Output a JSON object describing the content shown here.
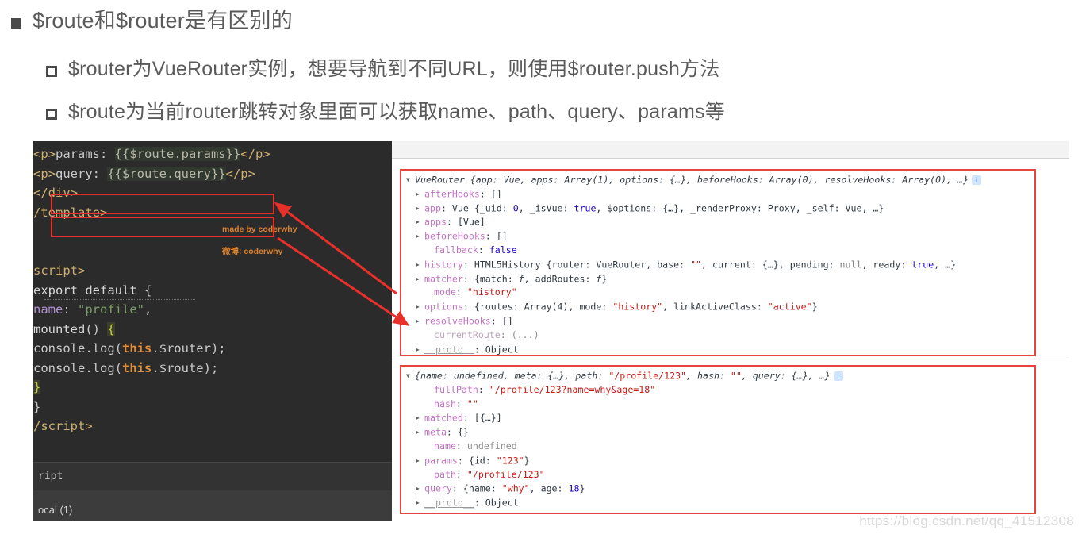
{
  "slide": {
    "bullets": [
      {
        "level": 1,
        "marker": "filled-square",
        "text": "$route和$router是有区别的"
      },
      {
        "level": 2,
        "marker": "hollow-square",
        "text": "$router为VueRouter实例，想要导航到不同URL，则使用$router.push方法"
      },
      {
        "level": 2,
        "marker": "hollow-square",
        "text": "$route为当前router跳转对象里面可以获取name、path、query、params等"
      }
    ]
  },
  "editor": {
    "watermark_line1": "made by coderwhy",
    "watermark_line2": "微博: coderwhy",
    "status_bar": "ript",
    "bottom_bar": "ocal (1)",
    "lines": [
      {
        "indent": 3,
        "parts": [
          {
            "t": "<p>",
            "c": "c-tag"
          },
          {
            "t": "params: ",
            "c": "c-plain"
          },
          {
            "t": "{{$route.params}}",
            "c": "c-mustache"
          },
          {
            "t": "</p>",
            "c": "c-tag"
          }
        ]
      },
      {
        "indent": 3,
        "parts": [
          {
            "t": "<p>",
            "c": "c-tag"
          },
          {
            "t": "query: ",
            "c": "c-plain"
          },
          {
            "t": "{{$route.query}}",
            "c": "c-mustache"
          },
          {
            "t": "</p>",
            "c": "c-tag"
          }
        ]
      },
      {
        "indent": 1,
        "parts": [
          {
            "t": "</div>",
            "c": "c-tag"
          }
        ]
      },
      {
        "indent": 0,
        "parts": [
          {
            "t": "/template>",
            "c": "c-tag"
          }
        ]
      },
      {
        "indent": 0,
        "parts": [
          {
            "t": "",
            "c": "c-plain"
          }
        ]
      },
      {
        "indent": 0,
        "parts": [
          {
            "t": "",
            "c": "c-plain"
          }
        ]
      },
      {
        "indent": 0,
        "parts": [
          {
            "t": "script>",
            "c": "c-tag"
          }
        ]
      },
      {
        "indent": 1,
        "parts": [
          {
            "t": "export default",
            "c": "c-kw"
          },
          {
            "t": " {",
            "c": "c-plain"
          }
        ]
      },
      {
        "indent": 2,
        "parts": [
          {
            "t": "name",
            "c": "c-key"
          },
          {
            "t": ": ",
            "c": "c-plain"
          },
          {
            "t": "\"profile\"",
            "c": "c-str"
          },
          {
            "t": ",",
            "c": "c-plain"
          }
        ]
      },
      {
        "indent": 2,
        "parts": [
          {
            "t": "mounted",
            "c": "c-fn"
          },
          {
            "t": "() ",
            "c": "c-plain"
          },
          {
            "t": "{",
            "c": "c-brace"
          }
        ]
      },
      {
        "indent": 3,
        "parts": [
          {
            "t": "console.log(",
            "c": "c-plain"
          },
          {
            "t": "this",
            "c": "c-this"
          },
          {
            "t": ".$router);",
            "c": "c-plain"
          }
        ]
      },
      {
        "indent": 3,
        "parts": [
          {
            "t": "console.log(",
            "c": "c-plain"
          },
          {
            "t": "this",
            "c": "c-this"
          },
          {
            "t": ".$route);",
            "c": "c-plain"
          }
        ]
      },
      {
        "indent": 2,
        "parts": [
          {
            "t": "}",
            "c": "c-brace"
          }
        ]
      },
      {
        "indent": 1,
        "parts": [
          {
            "t": "}",
            "c": "c-plain"
          }
        ]
      },
      {
        "indent": 0,
        "parts": [
          {
            "t": "/script>",
            "c": "c-tag"
          }
        ]
      }
    ],
    "highlight_boxes": [
      {
        "name": "console-log-router",
        "code": "console.log(this.$router);"
      },
      {
        "name": "console-log-route",
        "code": "console.log(this.$route);"
      }
    ]
  },
  "devtools": {
    "entries": [
      {
        "name": "vuerouter-object",
        "rows": [
          {
            "lvl": 0,
            "tri": "▼",
            "parts": [
              {
                "t": "VueRouter {app: Vue, apps: Array(1), options: {…}, beforeHooks: Array(0), resolveHooks: Array(0), …}",
                "c": "v-obj"
              }
            ],
            "badge": "i"
          },
          {
            "lvl": 1,
            "tri": "▶",
            "parts": [
              {
                "t": "afterHooks",
                "c": "k-prop"
              },
              {
                "t": ": []",
                "c": "v-plain"
              }
            ]
          },
          {
            "lvl": 1,
            "tri": "▶",
            "parts": [
              {
                "t": "app",
                "c": "k-prop"
              },
              {
                "t": ": Vue {_uid: ",
                "c": "v-plain"
              },
              {
                "t": "0",
                "c": "v-num"
              },
              {
                "t": ", _isVue: ",
                "c": "v-plain"
              },
              {
                "t": "true",
                "c": "v-bool"
              },
              {
                "t": ", $options: {…}, _renderProxy: Proxy, _self: Vue, …}",
                "c": "v-plain"
              }
            ]
          },
          {
            "lvl": 1,
            "tri": "▶",
            "parts": [
              {
                "t": "apps",
                "c": "k-prop"
              },
              {
                "t": ": [Vue]",
                "c": "v-plain"
              }
            ]
          },
          {
            "lvl": 1,
            "tri": "▶",
            "parts": [
              {
                "t": "beforeHooks",
                "c": "k-prop"
              },
              {
                "t": ": []",
                "c": "v-plain"
              }
            ]
          },
          {
            "lvl": 2,
            "tri": "",
            "parts": [
              {
                "t": "fallback",
                "c": "k-prop"
              },
              {
                "t": ": ",
                "c": "v-plain"
              },
              {
                "t": "false",
                "c": "v-bool"
              }
            ]
          },
          {
            "lvl": 1,
            "tri": "▶",
            "parts": [
              {
                "t": "history",
                "c": "k-prop"
              },
              {
                "t": ": HTML5History {router: VueRouter, base: ",
                "c": "v-plain"
              },
              {
                "t": "\"\"",
                "c": "v-str"
              },
              {
                "t": ", current: {…}, pending: ",
                "c": "v-plain"
              },
              {
                "t": "null",
                "c": "v-null"
              },
              {
                "t": ", ready: ",
                "c": "v-plain"
              },
              {
                "t": "true",
                "c": "v-bool"
              },
              {
                "t": ", …}",
                "c": "v-plain"
              }
            ]
          },
          {
            "lvl": 1,
            "tri": "▶",
            "parts": [
              {
                "t": "matcher",
                "c": "k-prop"
              },
              {
                "t": ": {match: ",
                "c": "v-plain"
              },
              {
                "t": "f",
                "c": "v-fn"
              },
              {
                "t": ", addRoutes: ",
                "c": "v-plain"
              },
              {
                "t": "f",
                "c": "v-fn"
              },
              {
                "t": "}",
                "c": "v-plain"
              }
            ]
          },
          {
            "lvl": 2,
            "tri": "",
            "parts": [
              {
                "t": "mode",
                "c": "k-prop"
              },
              {
                "t": ": ",
                "c": "v-plain"
              },
              {
                "t": "\"history\"",
                "c": "v-str"
              }
            ]
          },
          {
            "lvl": 1,
            "tri": "▶",
            "parts": [
              {
                "t": "options",
                "c": "k-prop"
              },
              {
                "t": ": {routes: Array(4), mode: ",
                "c": "v-plain"
              },
              {
                "t": "\"history\"",
                "c": "v-str"
              },
              {
                "t": ", linkActiveClass: ",
                "c": "v-plain"
              },
              {
                "t": "\"active\"",
                "c": "v-str"
              },
              {
                "t": "}",
                "c": "v-plain"
              }
            ]
          },
          {
            "lvl": 1,
            "tri": "▶",
            "parts": [
              {
                "t": "resolveHooks",
                "c": "k-prop"
              },
              {
                "t": ": []",
                "c": "v-plain"
              }
            ]
          },
          {
            "lvl": 2,
            "tri": "",
            "parts": [
              {
                "t": "currentRoute",
                "c": "k-propd"
              },
              {
                "t": ": (...)",
                "c": "v-undef"
              }
            ]
          },
          {
            "lvl": 1,
            "tri": "▶",
            "parts": [
              {
                "t": "__proto__",
                "c": "proto"
              },
              {
                "t": ": Object",
                "c": "v-plain"
              }
            ]
          }
        ]
      },
      {
        "name": "route-object",
        "rows": [
          {
            "lvl": 0,
            "tri": "▼",
            "parts": [
              {
                "t": "{name: undefined, meta: {…}, path: ",
                "c": "v-obj"
              },
              {
                "t": "\"/profile/123\"",
                "c": "v-str"
              },
              {
                "t": ", hash: ",
                "c": "v-obj"
              },
              {
                "t": "\"\"",
                "c": "v-str"
              },
              {
                "t": ", query: {…}, …}",
                "c": "v-obj"
              }
            ],
            "badge": "i"
          },
          {
            "lvl": 2,
            "tri": "",
            "parts": [
              {
                "t": "fullPath",
                "c": "k-prop"
              },
              {
                "t": ": ",
                "c": "v-plain"
              },
              {
                "t": "\"/profile/123?name=why&age=18\"",
                "c": "v-str"
              }
            ]
          },
          {
            "lvl": 2,
            "tri": "",
            "parts": [
              {
                "t": "hash",
                "c": "k-prop"
              },
              {
                "t": ": ",
                "c": "v-plain"
              },
              {
                "t": "\"\"",
                "c": "v-str"
              }
            ]
          },
          {
            "lvl": 1,
            "tri": "▶",
            "parts": [
              {
                "t": "matched",
                "c": "k-prop"
              },
              {
                "t": ": [{…}]",
                "c": "v-plain"
              }
            ]
          },
          {
            "lvl": 1,
            "tri": "▶",
            "parts": [
              {
                "t": "meta",
                "c": "k-prop"
              },
              {
                "t": ": {}",
                "c": "v-plain"
              }
            ]
          },
          {
            "lvl": 2,
            "tri": "",
            "parts": [
              {
                "t": "name",
                "c": "k-prop"
              },
              {
                "t": ": ",
                "c": "v-plain"
              },
              {
                "t": "undefined",
                "c": "v-undef"
              }
            ]
          },
          {
            "lvl": 1,
            "tri": "▶",
            "parts": [
              {
                "t": "params",
                "c": "k-prop"
              },
              {
                "t": ": {id: ",
                "c": "v-plain"
              },
              {
                "t": "\"123\"",
                "c": "v-str"
              },
              {
                "t": "}",
                "c": "v-plain"
              }
            ]
          },
          {
            "lvl": 2,
            "tri": "",
            "parts": [
              {
                "t": "path",
                "c": "k-prop"
              },
              {
                "t": ": ",
                "c": "v-plain"
              },
              {
                "t": "\"/profile/123\"",
                "c": "v-str"
              }
            ]
          },
          {
            "lvl": 1,
            "tri": "▶",
            "parts": [
              {
                "t": "query",
                "c": "k-prop"
              },
              {
                "t": ": {name: ",
                "c": "v-plain"
              },
              {
                "t": "\"why\"",
                "c": "v-str"
              },
              {
                "t": ", age: ",
                "c": "v-plain"
              },
              {
                "t": "18",
                "c": "v-num"
              },
              {
                "t": "}",
                "c": "v-plain"
              }
            ]
          },
          {
            "lvl": 1,
            "tri": "▶",
            "parts": [
              {
                "t": "__proto__",
                "c": "proto"
              },
              {
                "t": ": Object",
                "c": "v-plain"
              }
            ]
          }
        ]
      }
    ]
  },
  "watermark": "https://blog.csdn.net/qq_41512308",
  "colors": {
    "annotation_red": "#e8302a",
    "editor_bg": "#2b2b2b",
    "marker_gray": "#4a4a4a",
    "text_gray": "#5a5a5a",
    "watermark_orange": "#d98232"
  }
}
